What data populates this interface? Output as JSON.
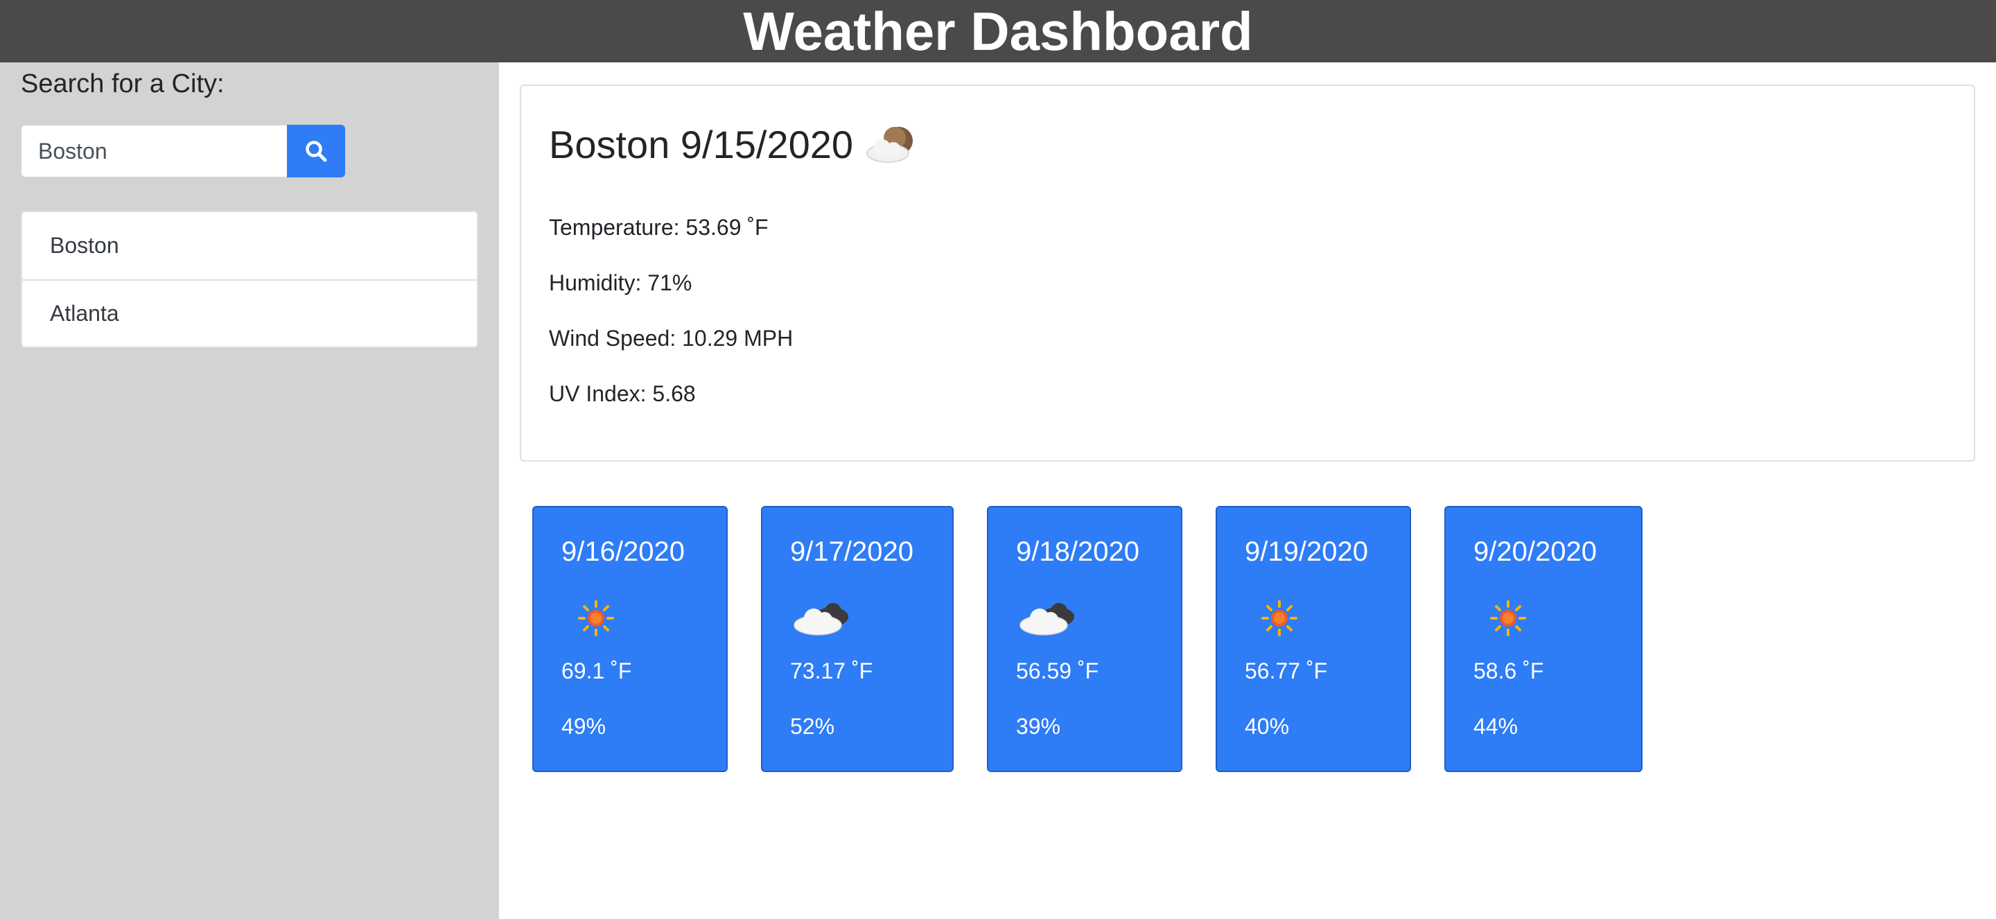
{
  "header": {
    "title": "Weather Dashboard"
  },
  "sidebar": {
    "search_heading": "Search for a City:",
    "search_value": "Boston",
    "search_icon": "search-icon",
    "history": [
      "Boston",
      "Atlanta"
    ]
  },
  "current": {
    "title": "Boston 9/15/2020",
    "icon": "cloud-moon-icon",
    "temperature": "Temperature: 53.69 ˚F",
    "humidity": "Humidity: 71%",
    "wind": "Wind Speed: 10.29 MPH",
    "uv": "UV Index: 5.68"
  },
  "forecast": [
    {
      "date": "9/16/2020",
      "icon": "sun-icon",
      "temp": "69.1 ˚F",
      "humidity": "49%"
    },
    {
      "date": "9/17/2020",
      "icon": "cloud-icon",
      "temp": "73.17 ˚F",
      "humidity": "52%"
    },
    {
      "date": "9/18/2020",
      "icon": "cloud-icon",
      "temp": "56.59 ˚F",
      "humidity": "39%"
    },
    {
      "date": "9/19/2020",
      "icon": "sun-icon",
      "temp": "56.77 ˚F",
      "humidity": "40%"
    },
    {
      "date": "9/20/2020",
      "icon": "sun-icon",
      "temp": "58.6 ˚F",
      "humidity": "44%"
    }
  ],
  "colors": {
    "header_bg": "#4a4a4a",
    "sidebar_bg": "#d3d3d3",
    "accent_blue": "#2e7cf6"
  }
}
